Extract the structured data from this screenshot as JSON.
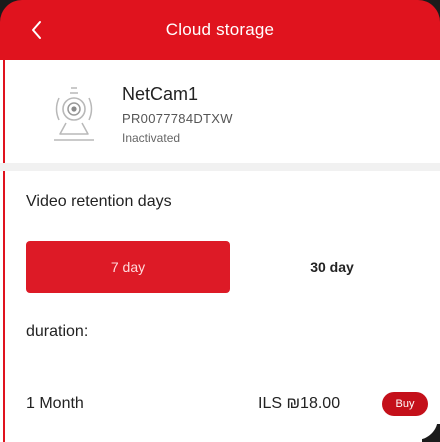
{
  "header": {
    "title": "Cloud storage",
    "back_icon": "chevron-left-icon"
  },
  "device": {
    "icon": "camera-icon",
    "name": "NetCam1",
    "serial": "PR0077784DTXW",
    "status": "Inactivated"
  },
  "retention": {
    "title": "Video retention days",
    "options": [
      {
        "label": "7 day",
        "selected": true
      },
      {
        "label": "30 day",
        "selected": false
      }
    ]
  },
  "duration": {
    "label": "duration:"
  },
  "plans": [
    {
      "name": "1 Month",
      "price": "ILS ₪18.00",
      "buy_label": "Buy"
    }
  ],
  "colors": {
    "accent": "#e0131e",
    "buy": "#c4101a"
  }
}
